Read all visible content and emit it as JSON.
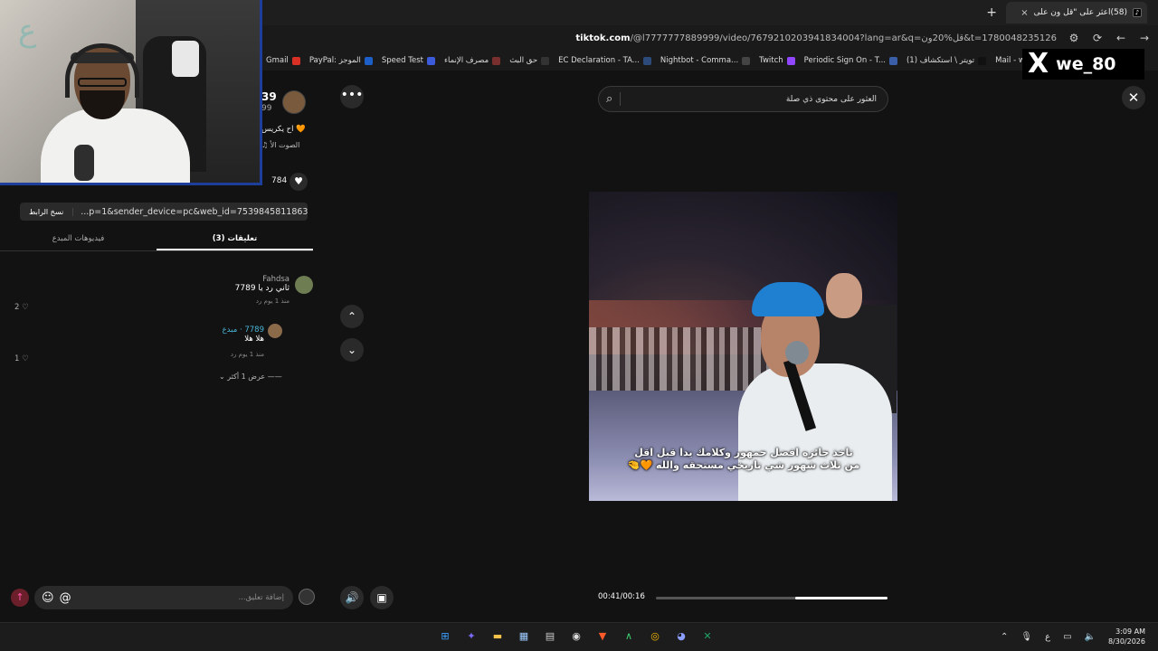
{
  "browser": {
    "new_tab": "+",
    "tab_title": "(58)اعثر على \"قل ون على",
    "tab_close": "×",
    "url_domain": "tiktok.com",
    "url_rest": "/@l7777777889999/video/7679210203941834004?lang=ar&q=قل%20ون&t=1780048235126"
  },
  "bookmarks": [
    {
      "label": "Gmail",
      "color": "#d93025"
    },
    {
      "label": "PayPal: الموجز",
      "color": "#1d5fc9"
    },
    {
      "label": "Speed Test",
      "color": "#3b5bdb"
    },
    {
      "label": "مصرف الإنماء",
      "color": "#7a2f2f"
    },
    {
      "label": "حق البث",
      "color": "#333333"
    },
    {
      "label": "EC Declaration - TA...",
      "color": "#2d4b7a"
    },
    {
      "label": "Nightbot - Comma...",
      "color": "#444444"
    },
    {
      "label": "Twitch",
      "color": "#9146ff"
    },
    {
      "label": "Periodic Sign On - T...",
      "color": "#3a5fa8"
    },
    {
      "label": "(1) تويتر \\ استكشاف",
      "color": "#111111"
    },
    {
      "label": "Mail - waleed 159 -...",
      "color": "#0b65c2"
    }
  ],
  "x_overlay": {
    "logo": "X",
    "handle": "we_80"
  },
  "video_info": {
    "author_num": "39",
    "author_num2": "99",
    "description": "اح يكريس 🧡",
    "sound": "♫ الصوت الأ",
    "likes": "784"
  },
  "share": {
    "copy_label": "نسخ الرابط",
    "link": "...p=1&sender_device=pc&web_id=7539845811863340551"
  },
  "tabs": {
    "creator_videos": "فيديوهات المبدع",
    "comments": "(3) تعليقات"
  },
  "comments": [
    {
      "name": "Fahdsa",
      "text": "ثاني رد يا 7789",
      "meta": "منذ 1 يوم   رد",
      "likes": "2"
    },
    {
      "name": "7789 · مبدع",
      "text": "هلا هلا",
      "meta": "منذ 1 يوم   رد",
      "likes": "1"
    }
  ],
  "more_replies": "عرض 1 أكثر",
  "comment_input": {
    "placeholder": "إضافة تعليق..."
  },
  "search": {
    "placeholder": "العثور على محتوى ذي صلة"
  },
  "video": {
    "caption": "تاخذ جائزه افضل جمهور وكلامك يدا قبل اقل من ثلاث شهور شي تاريخي مستحقه والله 🧡🤏",
    "time": "00:41/00:16",
    "progress": 0.4
  },
  "taskbar": {
    "time": "3:09 AM",
    "date": "8/30/2026",
    "lang": "ع"
  }
}
